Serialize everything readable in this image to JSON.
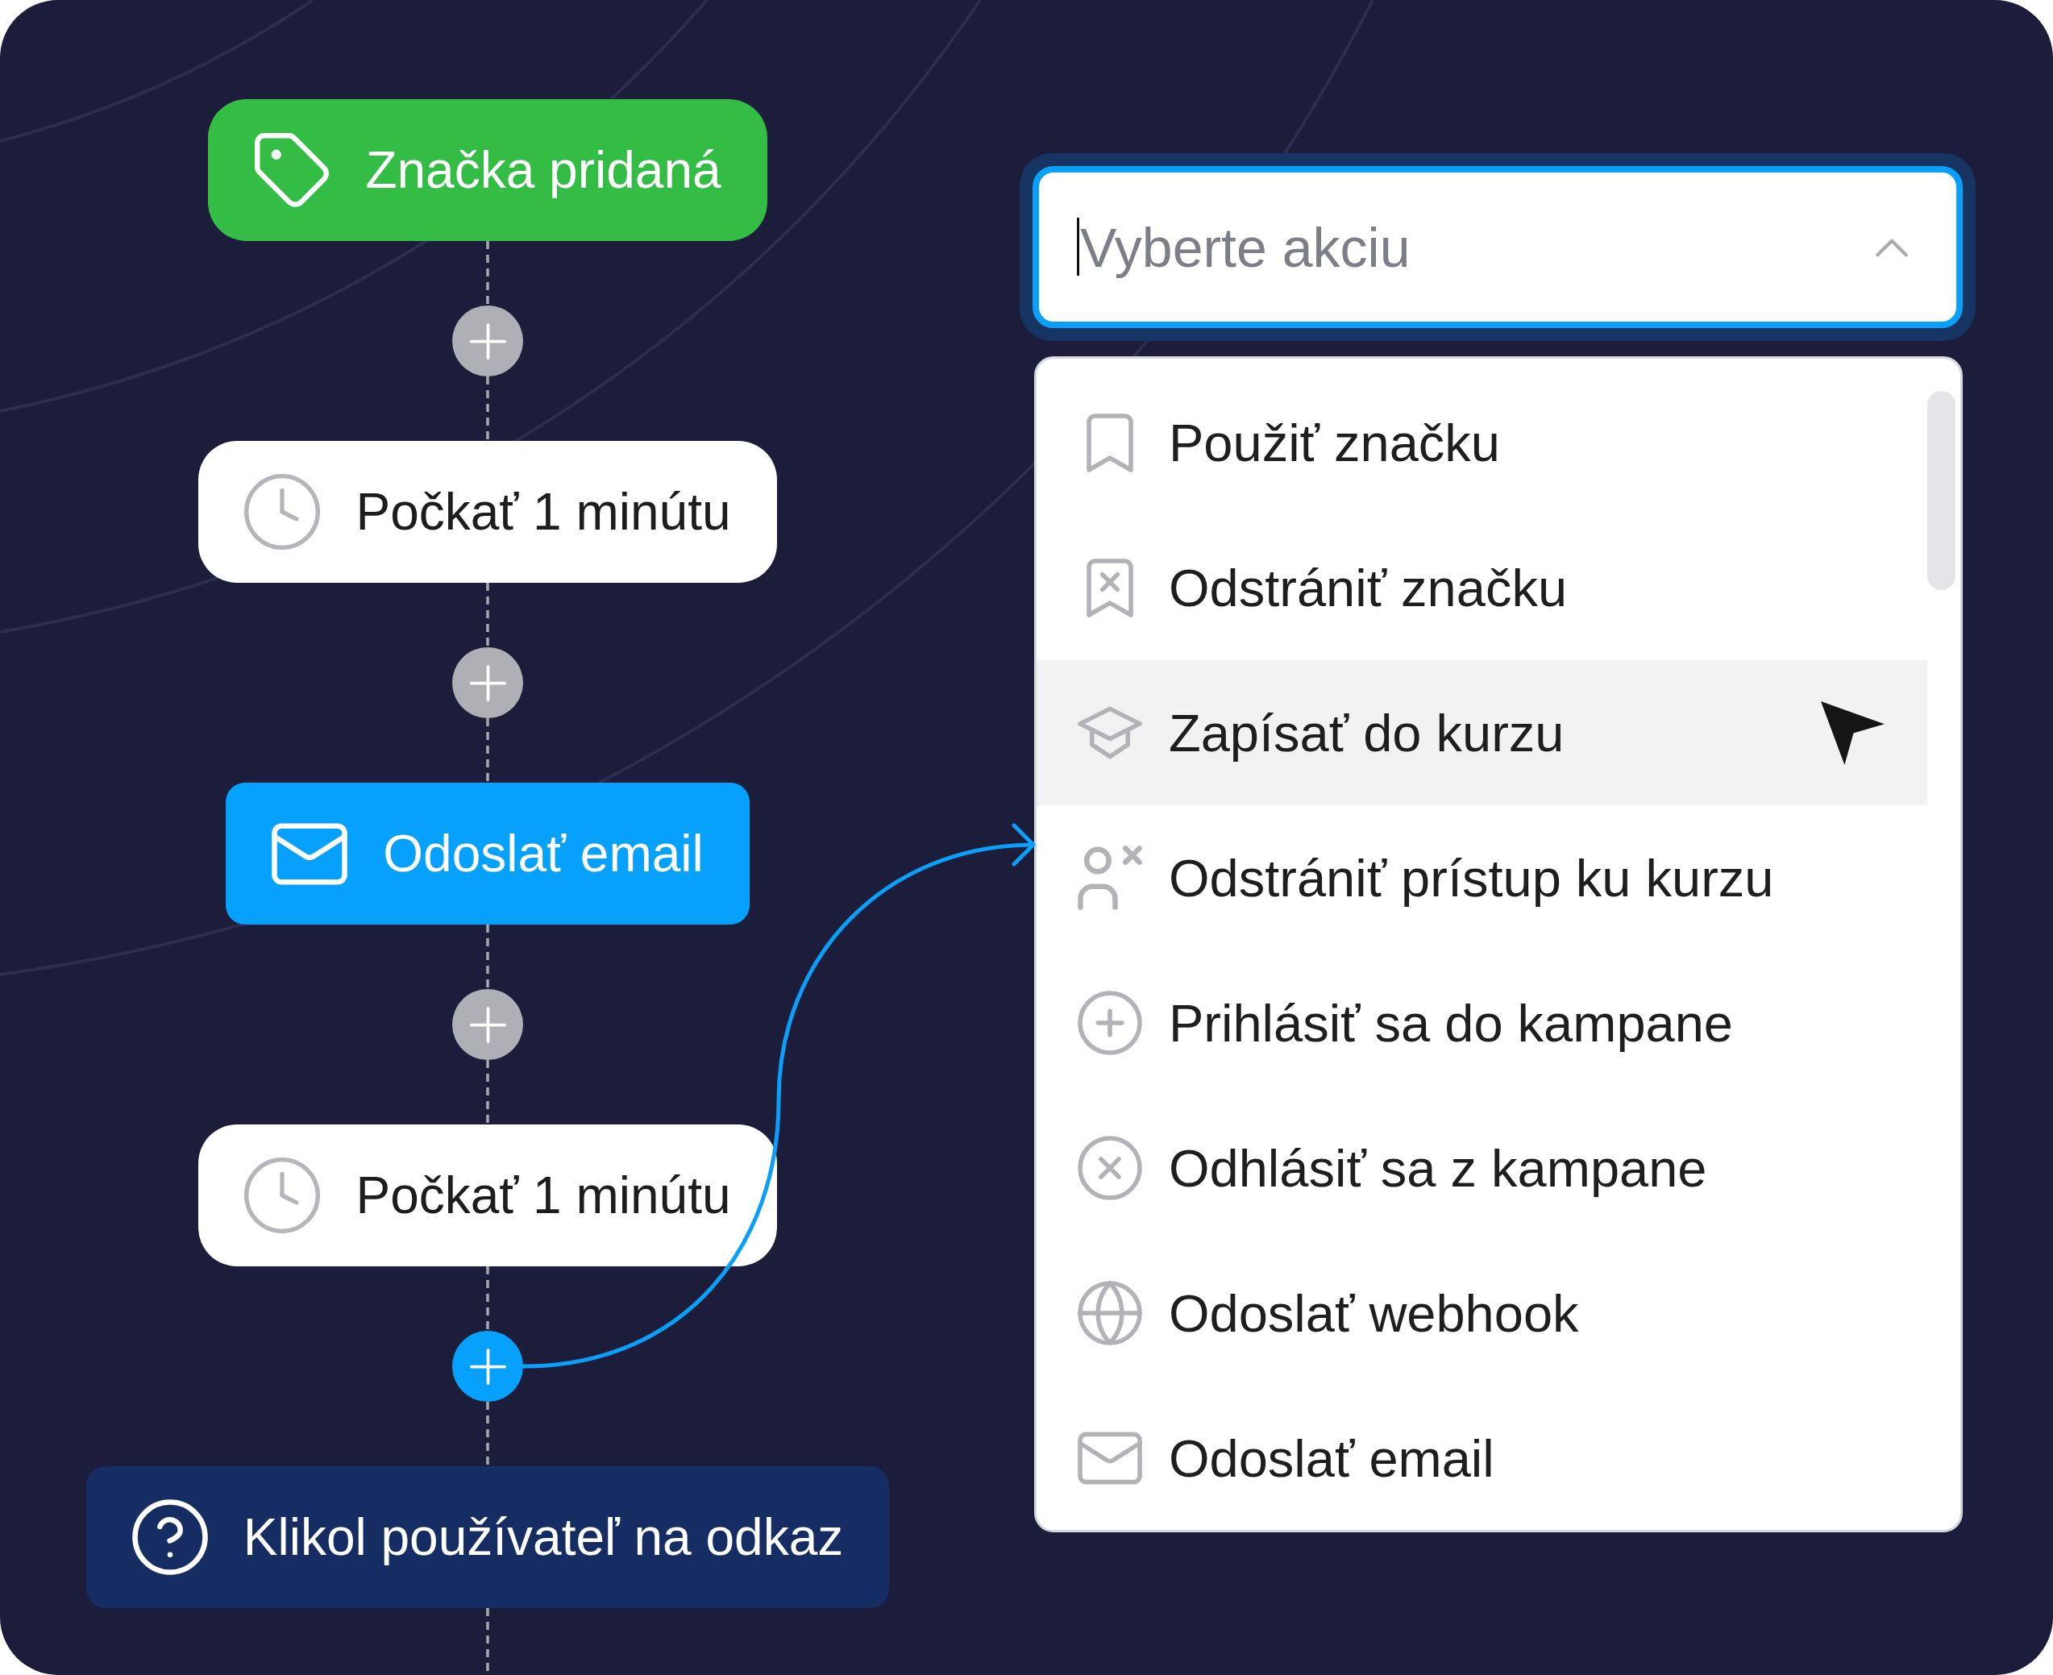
{
  "flow": [
    {
      "kind": "trigger",
      "label": "Značka pridaná"
    },
    {
      "kind": "add",
      "selected": false
    },
    {
      "kind": "wait",
      "label": "Počkať 1 minútu"
    },
    {
      "kind": "add",
      "selected": false
    },
    {
      "kind": "email",
      "label": "Odoslať email"
    },
    {
      "kind": "add",
      "selected": false
    },
    {
      "kind": "wait",
      "label": "Počkať 1 minútu"
    },
    {
      "kind": "add",
      "selected": true
    },
    {
      "kind": "condition",
      "label": "Klikol používateľ na odkaz"
    }
  ],
  "action_select": {
    "placeholder": "Vyberte akciu",
    "focused": true,
    "expanded": true,
    "options": [
      {
        "kind": "tag",
        "label": "Použiť značku",
        "selected": false
      },
      {
        "kind": "untag",
        "label": "Odstrániť značku",
        "selected": false
      },
      {
        "kind": "enroll",
        "label": "Zapísať do kurzu",
        "selected": true
      },
      {
        "kind": "revoke",
        "label": "Odstrániť prístup ku kurzu",
        "selected": false
      },
      {
        "kind": "subscribe",
        "label": "Prihlásiť sa do kampane",
        "selected": false
      },
      {
        "kind": "unsubscribe",
        "label": "Odhlásiť sa z kampane",
        "selected": false
      },
      {
        "kind": "webhook",
        "label": "Odoslať webhook",
        "selected": false
      },
      {
        "kind": "email",
        "label": "Odoslať email",
        "selected": false
      }
    ]
  }
}
